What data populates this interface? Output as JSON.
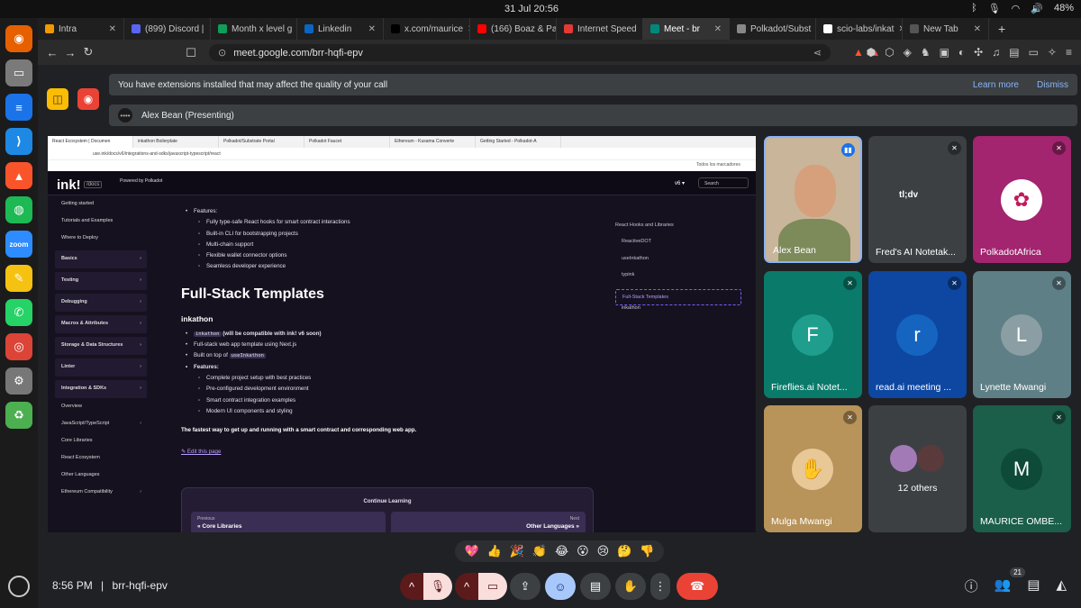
{
  "os": {
    "clock": "31 Jul  20:56",
    "battery": "48%"
  },
  "dock": {
    "apps": [
      {
        "name": "firefox",
        "glyph": "◉",
        "color": "#e66000"
      },
      {
        "name": "files",
        "glyph": "▭",
        "color": "#7a7a7a"
      },
      {
        "name": "docs",
        "glyph": "≡",
        "color": "#1a73e8"
      },
      {
        "name": "vscode",
        "glyph": "⟩",
        "color": "#1e88e5"
      },
      {
        "name": "brave",
        "glyph": "▲",
        "color": "#fb542b"
      },
      {
        "name": "spotify",
        "glyph": "◍",
        "color": "#1db954"
      },
      {
        "name": "zoom",
        "glyph": "zoom",
        "color": "#2d8cff"
      },
      {
        "name": "text-editor",
        "glyph": "✎",
        "color": "#f5c211"
      },
      {
        "name": "whatsapp",
        "glyph": "✆",
        "color": "#25d366"
      },
      {
        "name": "chrome",
        "glyph": "◎",
        "color": "#db4437"
      },
      {
        "name": "settings",
        "glyph": "⚙",
        "color": "#777777"
      },
      {
        "name": "trash",
        "glyph": "♻",
        "color": "#4caf50"
      }
    ]
  },
  "browser": {
    "tabs": [
      {
        "label": "Intra",
        "color": "#f29900"
      },
      {
        "label": "(899) Discord |",
        "color": "#5865f2"
      },
      {
        "label": "Month x level g",
        "color": "#0f9d58"
      },
      {
        "label": "Linkedin",
        "color": "#0a66c2"
      },
      {
        "label": "x.com/maurice",
        "color": "#000000"
      },
      {
        "label": "(166) Boaz & Pa",
        "color": "#ff0000"
      },
      {
        "label": "Internet Speed",
        "color": "#e53935"
      },
      {
        "label": "Meet - br",
        "color": "#00897b",
        "active": true
      },
      {
        "label": "Polkadot/Subst",
        "color": "#888888"
      },
      {
        "label": "scio-labs/inkat",
        "color": "#ffffff"
      },
      {
        "label": "New Tab",
        "color": "#555555"
      }
    ],
    "url": "meet.google.com/brr-hqfi-epv"
  },
  "meet": {
    "banner_text": "You have extensions installed that may affect the quality of your call",
    "learn_more": "Learn more",
    "dismiss": "Dismiss",
    "presenter": "Alex Bean (Presenting)",
    "time": "8:56 PM",
    "separator": "|",
    "meeting_code": "brr-hqfi-epv",
    "participant_count": "21",
    "reactions": [
      "💖",
      "👍",
      "🎉",
      "👏",
      "😂",
      "😮",
      "😢",
      "🤔",
      "👎"
    ],
    "tiles": [
      {
        "name": "Alex Bean",
        "type": "video",
        "col": 0,
        "row": 0
      },
      {
        "name": "Fred's AI Notetak...",
        "type": "bot",
        "col": 1,
        "row": 0
      },
      {
        "name": "PolkadotAfrica",
        "type": "logo",
        "bg": "#a3246f",
        "col": 2,
        "row": 0
      },
      {
        "name": "Fireflies.ai Notet...",
        "letter": "F",
        "bg": "#0a7a6a",
        "avatar": "#1f9e8e",
        "col": 0,
        "row": 1
      },
      {
        "name": "read.ai meeting ...",
        "letter": "r",
        "bg": "#0d47a1",
        "avatar": "#1565c0",
        "col": 1,
        "row": 1
      },
      {
        "name": "Lynette Mwangi",
        "letter": "L",
        "bg": "#5f7f86",
        "avatar": "#8a9ea3",
        "col": 2,
        "row": 1
      },
      {
        "name": "Mulga Mwangi",
        "type": "photo",
        "bg": "#b8935a",
        "col": 0,
        "row": 2
      },
      {
        "name": "12 others",
        "type": "others",
        "col": 1,
        "row": 2
      },
      {
        "name": "MAURICE OMBE...",
        "letter": "M",
        "bg": "#1b5e4a",
        "avatar": "#0d4a38",
        "col": 2,
        "row": 2
      }
    ]
  },
  "shared": {
    "tabs": [
      "React Ecosystem | Documen",
      "inkathon Boilerplate",
      "Polkadot/Substrate Portal",
      "Polkadot Faucet",
      "Ethereum - Kusama Converte",
      "Getting Started - Polkadot-A"
    ],
    "url": "use.ink/docs/v6/integrations-and-sdks/javascript-typescript/react",
    "bookmarks": "Todos los marcadores",
    "logo": "ink!",
    "docs_badge": "/docs",
    "powered": "Powered by Polkadot",
    "version": "v6 ▾",
    "search": "Search",
    "sidebar": [
      {
        "label": "Getting started",
        "section": false
      },
      {
        "label": "Tutorials and Examples",
        "section": false
      },
      {
        "label": "Where to Deploy",
        "section": false
      },
      {
        "label": "Basics",
        "section": true
      },
      {
        "label": "Testing",
        "section": true
      },
      {
        "label": "Debugging",
        "section": true
      },
      {
        "label": "Macros & Attributes",
        "section": true
      },
      {
        "label": "Storage & Data Structures",
        "section": true
      },
      {
        "label": "Linter",
        "section": true
      },
      {
        "label": "Integration & SDKs",
        "section": true
      },
      {
        "label": "Overview",
        "section": false
      },
      {
        "label": "JavaScript/TypeScript",
        "section": false
      },
      {
        "label": "Core Libraries",
        "section": false
      },
      {
        "label": "React Ecosystem",
        "section": false
      },
      {
        "label": "Other Languages",
        "section": false
      },
      {
        "label": "Ethereum Compatibility",
        "section": false
      }
    ],
    "features_heading": "Features:",
    "features": [
      "Fully type-safe React hooks for smart contract interactions",
      "Built-in CLI for bootstrapping projects",
      "Multi-chain support",
      "Flexible wallet connector options",
      "Seamless developer experience"
    ],
    "h2": "Full-Stack Templates",
    "h3": "inkathon",
    "ink_items": [
      {
        "code": "inkathon",
        "text": " (will be compatible with ink! v6 soon)"
      },
      {
        "code": "",
        "text": "Full-stack web app template using Next.js"
      },
      {
        "code": "useInkathon",
        "text": "Built on top of "
      }
    ],
    "ink_features": [
      "Complete project setup with best practices",
      "Pre-configured development environment",
      "Smart contract integration examples",
      "Modern UI components and styling"
    ],
    "tagline": "The fastest way to get up and running with a smart contract and corresponding web app.",
    "edit": "✎ Edit this page",
    "continue": "Continue Learning",
    "prev_label": "Previous",
    "prev_title": "« Core Libraries",
    "next_label": "Next",
    "next_title": "Other Languages »",
    "toc": [
      "React Hooks and Libraries",
      "ReactiveDOT",
      "useInkathon",
      "typink",
      "Full-Stack Templates",
      "inkathon"
    ]
  },
  "colors": {
    "accent": "#8ab4f8",
    "end_call": "#ea4335",
    "danger_btn": "#5c1a1a",
    "active_btn": "#a8c7fa"
  }
}
